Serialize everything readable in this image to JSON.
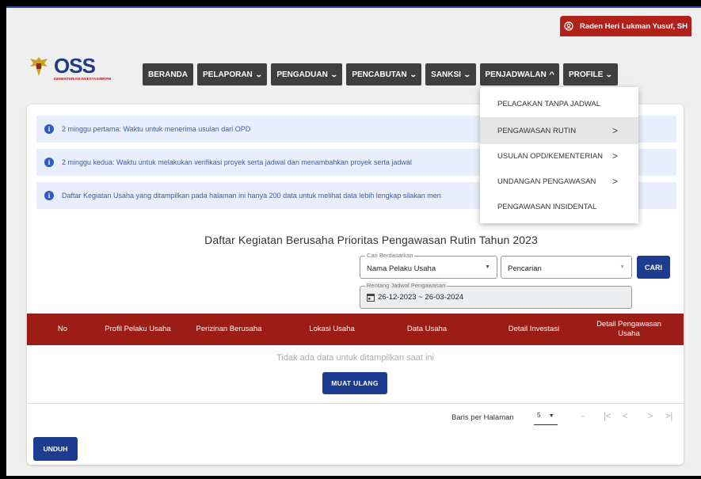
{
  "user": {
    "name": "Raden Heri Lukman Yusuf, SH",
    "icon": "user-circle-icon"
  },
  "logo": {
    "text": "OSS",
    "subtext": "KEMENTERIAN INVESTASI/BKPM"
  },
  "nav": [
    {
      "label": "BERANDA",
      "chevron": ""
    },
    {
      "label": "PELAPORAN",
      "chevron": "⌄"
    },
    {
      "label": "PENGADUAN",
      "chevron": "⌄"
    },
    {
      "label": "PENCABUTAN",
      "chevron": "⌄"
    },
    {
      "label": "SANKSI",
      "chevron": "⌄"
    },
    {
      "label": "PENJADWALAN",
      "chevron": "^"
    },
    {
      "label": "PROFILE",
      "chevron": "⌄"
    }
  ],
  "alerts": [
    "2 minggu pertama: Waktu untuk menerima usulan dari OPD",
    "2 minggu kedua: Waktu untuk melakukan verifikasi proyek serta jadwal dan menambahkan proyek serta jadwal",
    "Daftar Kegiatan Usaha yang ditampilkan pada halaman ini hanya 200 data untuk melihat data lebih lengkap silakan men"
  ],
  "title": "Daftar Kegiatan Berusaha Prioritas Pengawasan Rutin Tahun 2023",
  "search": {
    "by_label": "Cari Berdasarkan",
    "by_value": "Nama Pelaku Usaha",
    "query_value": "Pencarian",
    "button": "CARI"
  },
  "date_range": {
    "label": "Rentang Jadwal Pengawasan",
    "value": "26-12-2023 ~ 26-03-2024"
  },
  "table": {
    "headers": [
      "No",
      "Profil Pelaku Usaha",
      "Perizinan Berusaha",
      "Lokasi Usaha",
      "Data Usaha",
      "Detail Investasi",
      "Detail Pengawasan Usaha"
    ],
    "empty_text": "Tidak ada data untuk ditampilkan saat ini",
    "reload": "MUAT ULANG"
  },
  "pagination": {
    "rows_label": "Baris per Halaman",
    "rows_value": "5",
    "range": "-",
    "first": "|<",
    "prev": "<",
    "next": ">",
    "last": ">|"
  },
  "download": "UNDUH",
  "dropdown": [
    {
      "label": "PELACAKAN TANPA JADWAL",
      "sub": ""
    },
    {
      "label": "PENGAWASAN RUTIN",
      "sub": ">"
    },
    {
      "label": "USULAN OPD/KEMENTERIAN",
      "sub": ">"
    },
    {
      "label": "UNDANGAN PENGAWASAN",
      "sub": ">"
    },
    {
      "label": "PENGAWASAN INSIDENTAL",
      "sub": ""
    }
  ]
}
